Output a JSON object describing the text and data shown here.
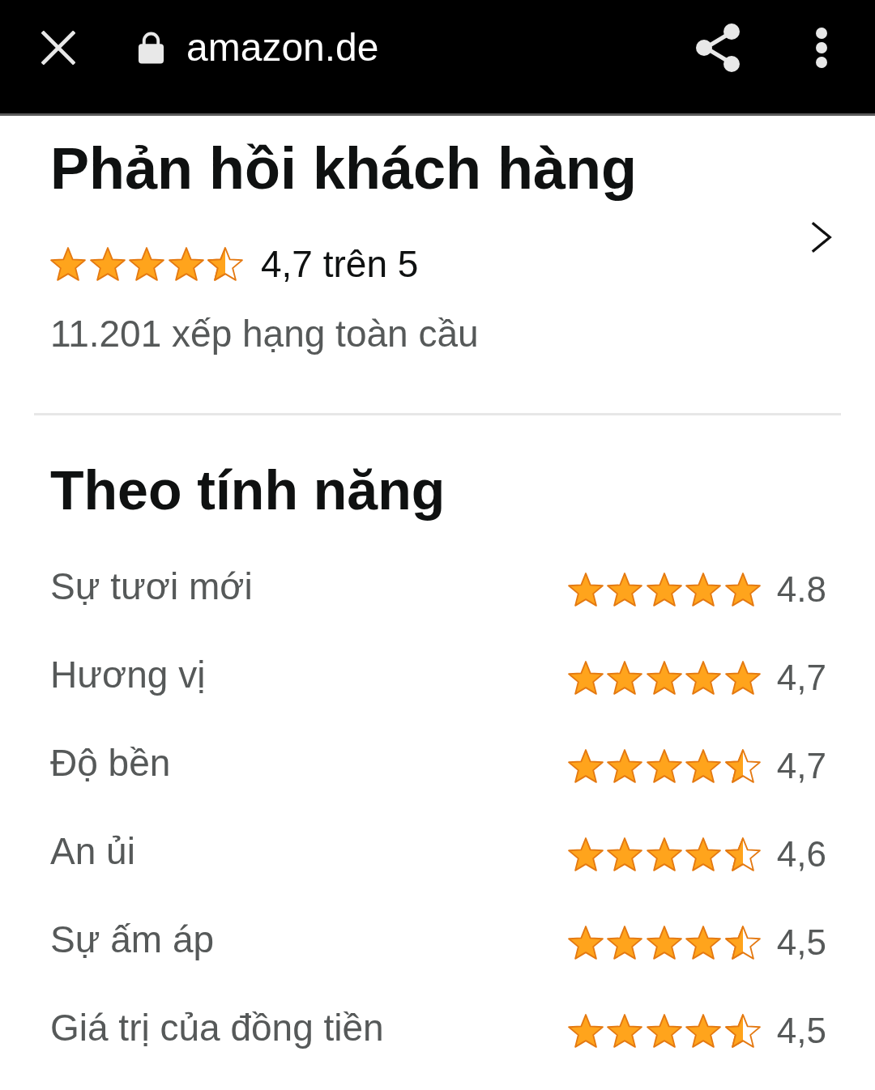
{
  "toolbar": {
    "url": "amazon.de"
  },
  "customer_reviews": {
    "title": "Phản hồi khách hàng",
    "stars": 4.5,
    "rating_text": "4,7 trên 5",
    "ratings_count": "11.201 xếp hạng toàn cầu"
  },
  "by_feature": {
    "title": "Theo tính năng",
    "features": [
      {
        "name": "Sự tươi mới",
        "stars": 5,
        "rating": "4.8"
      },
      {
        "name": "Hương vị",
        "stars": 5,
        "rating": "4,7"
      },
      {
        "name": "Độ bền",
        "stars": 4.5,
        "rating": "4,7"
      },
      {
        "name": "An ủi",
        "stars": 4.5,
        "rating": "4,6"
      },
      {
        "name": "Sự ấm áp",
        "stars": 4.5,
        "rating": "4,5"
      },
      {
        "name": "Giá trị của đồng tiền",
        "stars": 4.5,
        "rating": "4,5"
      }
    ]
  }
}
